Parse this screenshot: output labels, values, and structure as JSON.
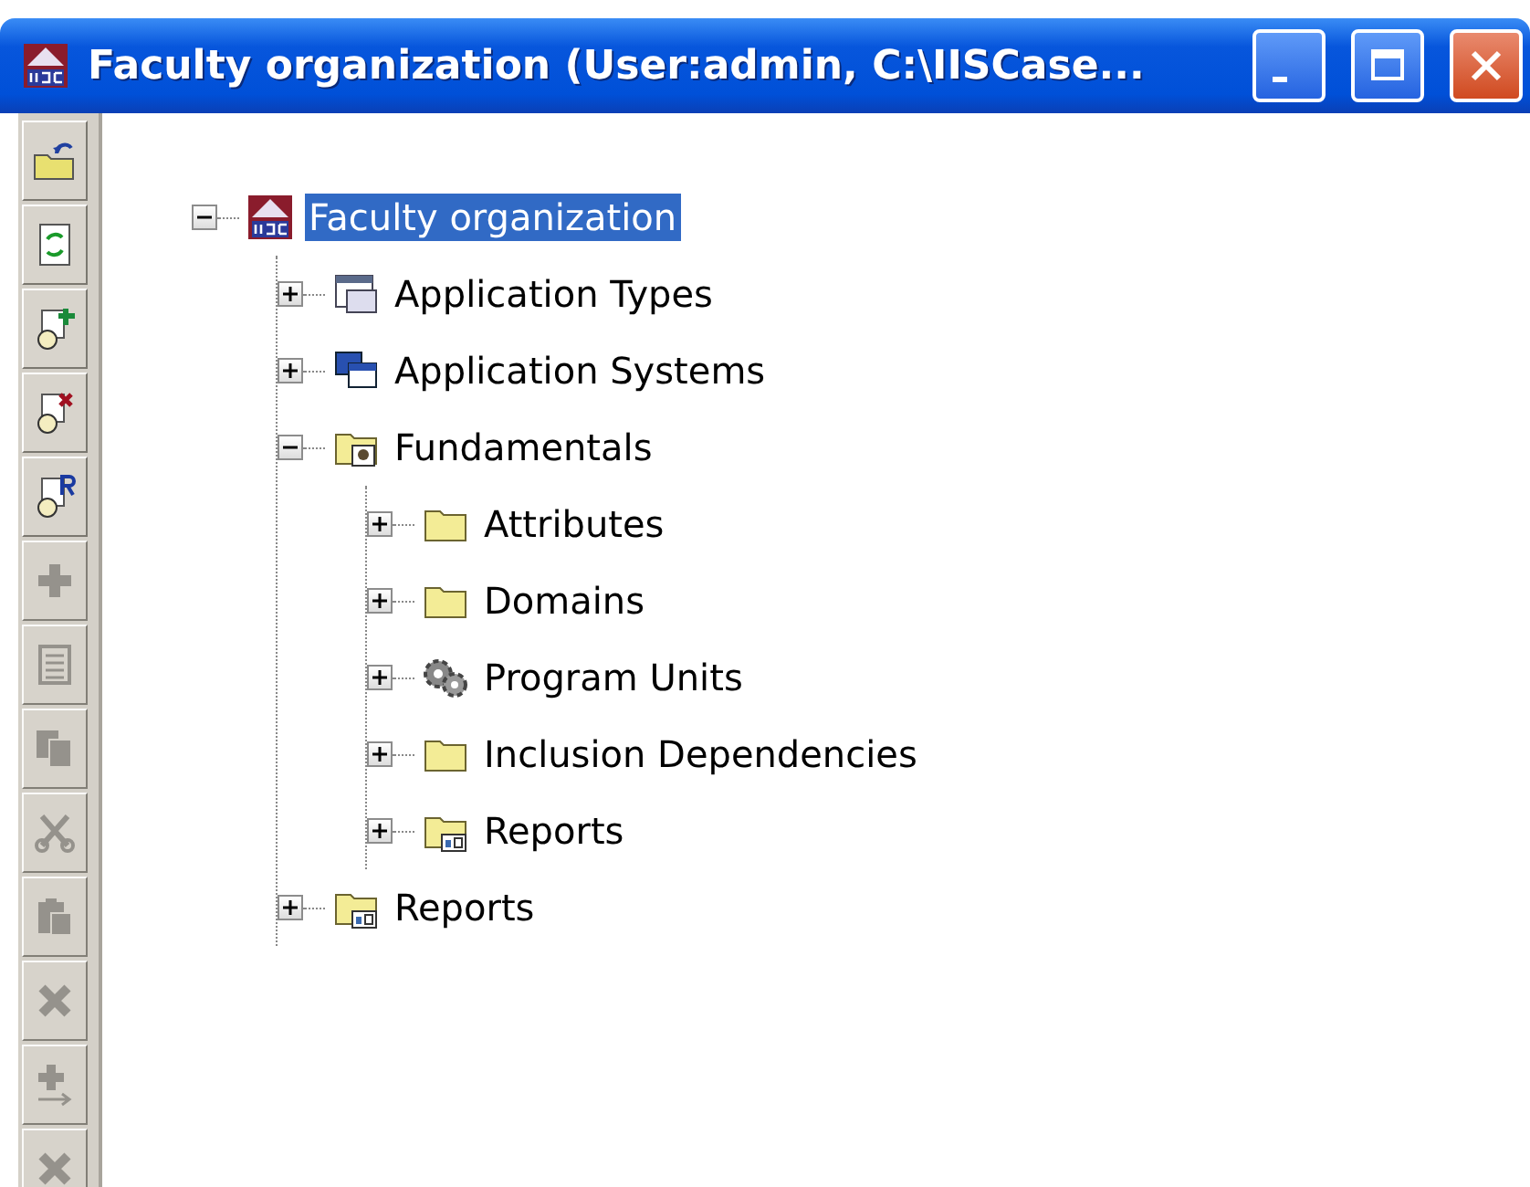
{
  "window": {
    "title": "Faculty organization (User:admin, C:\\IISCase..."
  },
  "toolbar": [
    {
      "kind": "folder-up",
      "disabled": false
    },
    {
      "kind": "refresh",
      "disabled": false
    },
    {
      "kind": "add-user",
      "disabled": false
    },
    {
      "kind": "remove-user",
      "disabled": false
    },
    {
      "kind": "rename-user",
      "disabled": false
    },
    {
      "kind": "plus",
      "disabled": true
    },
    {
      "kind": "list",
      "disabled": true
    },
    {
      "kind": "copy",
      "disabled": true
    },
    {
      "kind": "cut",
      "disabled": true
    },
    {
      "kind": "paste",
      "disabled": true
    },
    {
      "kind": "delete",
      "disabled": true
    },
    {
      "kind": "plus-arrow",
      "disabled": true
    },
    {
      "kind": "delete",
      "disabled": true
    }
  ],
  "tree": [
    {
      "label": "Faculty organization",
      "kind": "logo",
      "expanded": true,
      "selected": true,
      "children": [
        {
          "label": "Application Types",
          "kind": "window",
          "expanded": false,
          "selected": false
        },
        {
          "label": "Application Systems",
          "kind": "windows",
          "expanded": false,
          "selected": false
        },
        {
          "label": "Fundamentals",
          "kind": "folder-doc",
          "expanded": true,
          "selected": false,
          "children": [
            {
              "label": "Attributes",
              "kind": "folder",
              "expanded": false,
              "selected": false
            },
            {
              "label": "Domains",
              "kind": "folder",
              "expanded": false,
              "selected": false
            },
            {
              "label": "Program Units",
              "kind": "gears",
              "expanded": false,
              "selected": false
            },
            {
              "label": "Inclusion Dependencies",
              "kind": "folder",
              "expanded": false,
              "selected": false
            },
            {
              "label": "Reports",
              "kind": "folder-report",
              "expanded": false,
              "selected": false
            }
          ]
        },
        {
          "label": "Reports",
          "kind": "folder-report",
          "expanded": false,
          "selected": false
        }
      ]
    }
  ]
}
